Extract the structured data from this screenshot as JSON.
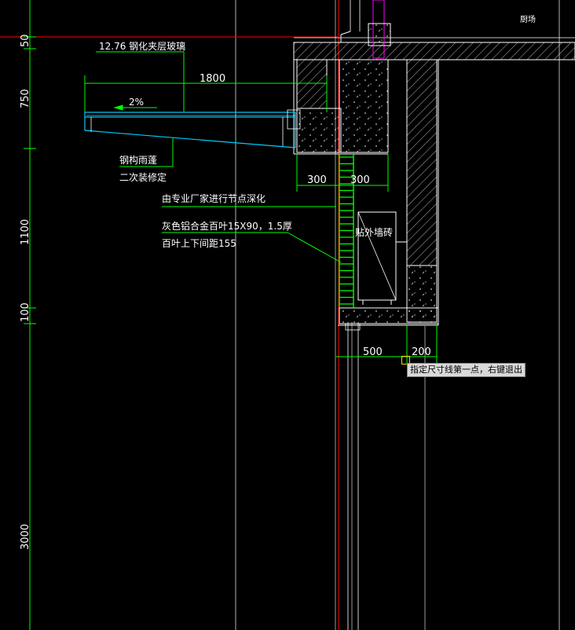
{
  "room_label": "厨场",
  "dimensions": {
    "vertical": [
      "50",
      "750",
      "1100",
      "100",
      "3000"
    ],
    "canopy_width": "1800",
    "wall_left": "300",
    "wall_right": "300",
    "bottom_left": "500",
    "bottom_right": "200"
  },
  "annotations": {
    "glass": "12.76 钢化夹层玻璃",
    "slope": "2%",
    "steel_canopy": "钢构雨蓬",
    "secondary_fitout": "二次装修定",
    "vendor_detail": "由专业厂家进行节点深化",
    "louver_spec": "灰色铝合金百叶15X90，1.5厚",
    "louver_spacing": "百叶上下间距155",
    "ac_unit": "贴外墙砖"
  },
  "command_prompt": "指定尺寸线第一点，右键退出",
  "colors": {
    "background": "#000000",
    "dim_line": "#00ff00",
    "wall": "#ffffff",
    "hatch": "#ffffff",
    "louver": "#00ff00",
    "canopy": "#00ccff",
    "axis": "#ff0000",
    "pipe": "#ff00ff",
    "prompt_bg": "#d9d9d9",
    "cursor": "#ffd400"
  }
}
